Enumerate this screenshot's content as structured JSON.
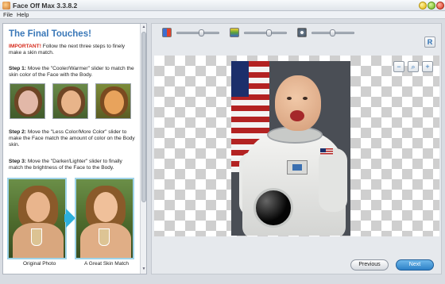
{
  "window": {
    "title": "Face Off Max  3.3.8.2"
  },
  "menu": {
    "file": "File",
    "help": "Help"
  },
  "left_panel": {
    "title": "The Final Touches!",
    "important_label": "IMPORTANT!",
    "important_text": " Follow the next three steps to finely make a skin match.",
    "step1_label": "Step 1:",
    "step1_text": " Move the \"Cooler/Warmer\" slider to match the skin color of the Face with the Body.",
    "step2_label": "Step 2:",
    "step2_text": " Move the \"Less Color/More Color\" slider to make the Face match the amount of color on the Body skin.",
    "step3_label": "Step 3:",
    "step3_text": " Move the \"Darker/Lighter\" slider to finally match the brightness of the Face to the Body.",
    "caption_original": "Original Photo",
    "caption_match": "A Great Skin Match"
  },
  "toolbar": {
    "sliders": [
      {
        "name": "cooler-warmer",
        "value": 0.6
      },
      {
        "name": "less-more-color",
        "value": 0.6
      },
      {
        "name": "darker-lighter",
        "value": 0.5
      }
    ],
    "help_glyph": "R"
  },
  "zoom": {
    "zoom_out": "−",
    "zoom_fit": "⌕",
    "zoom_in": "+"
  },
  "buttons": {
    "previous": "Previous",
    "next": "Next"
  }
}
